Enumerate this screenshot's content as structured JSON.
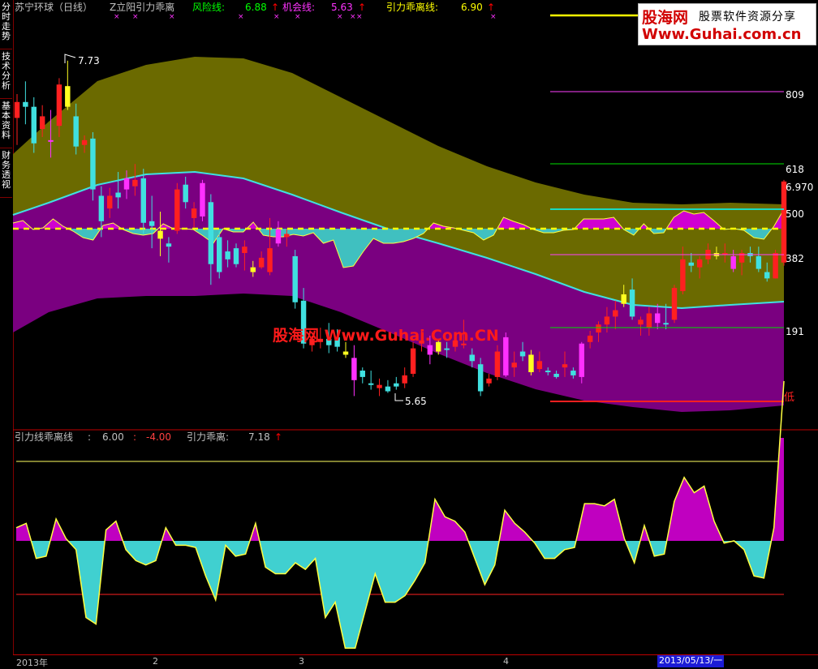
{
  "sidebar": {
    "tabs": [
      {
        "label": "分时走势"
      },
      {
        "label": "技术分析"
      },
      {
        "label": "基本资料"
      },
      {
        "label": "财务透视"
      }
    ]
  },
  "main_panel": {
    "title": "苏宁环球（日线）",
    "indicator_name": "Z立阳引力乖离",
    "risk_label": "风险线:",
    "risk_value": "6.88",
    "opportunity_label": "机会线:",
    "opportunity_value": "5.63",
    "gravity_label": "引力乖离线:",
    "gravity_value": "6.90",
    "high_marker": "7.73",
    "low_marker": "5.65",
    "current_price": "6.970",
    "levels": [
      "809",
      "618",
      "500",
      "382",
      "191",
      "低"
    ],
    "colors": {
      "risk": "#00ff00",
      "opportunity": "#ff33ff",
      "gravity": "#ffff00"
    }
  },
  "sub_panel": {
    "title": "引力线乖离线",
    "value1": "6.00",
    "value2": "-4.00",
    "label2": "引力乖离:",
    "value3": "7.18"
  },
  "dates": {
    "start": "2013年",
    "m2": "2",
    "m3": "3",
    "m4": "4",
    "cursor": "2013/05/13/一"
  },
  "logo": {
    "brand": "股海网",
    "slogan": "股票软件资源分享",
    "url": "Www.Guhai.com.cn"
  },
  "watermark": "股海网 Www.Guhai.Com.CN",
  "candles": [
    [
      7.37,
      7.52,
      7.2,
      7.47
    ],
    [
      7.47,
      7.6,
      7.33,
      7.44
    ],
    [
      7.44,
      7.5,
      7.15,
      7.21
    ],
    [
      7.3,
      7.45,
      7.25,
      7.38
    ],
    [
      7.23,
      7.42,
      7.12,
      7.22
    ],
    [
      7.32,
      7.62,
      7.25,
      7.58
    ],
    [
      7.57,
      7.73,
      7.42,
      7.44
    ],
    [
      7.38,
      7.46,
      7.14,
      7.19
    ],
    [
      7.2,
      7.26,
      7.15,
      7.23
    ],
    [
      7.24,
      7.28,
      6.85,
      6.92
    ],
    [
      6.88,
      6.94,
      6.62,
      6.72
    ],
    [
      6.8,
      6.93,
      6.74,
      6.88
    ],
    [
      6.9,
      7.03,
      6.8,
      6.87
    ],
    [
      6.92,
      7.04,
      6.86,
      6.99
    ],
    [
      6.94,
      7.08,
      6.88,
      6.98
    ],
    [
      6.99,
      7.05,
      6.64,
      6.71
    ],
    [
      6.72,
      6.88,
      6.55,
      6.69
    ],
    [
      6.66,
      6.78,
      6.5,
      6.61
    ],
    [
      6.58,
      6.62,
      6.46,
      6.56
    ],
    [
      6.66,
      6.96,
      6.64,
      6.92
    ],
    [
      6.95,
      7.0,
      6.8,
      6.84
    ],
    [
      6.74,
      6.84,
      6.68,
      6.8
    ],
    [
      6.75,
      6.98,
      6.72,
      6.96
    ],
    [
      6.84,
      6.89,
      6.32,
      6.45
    ],
    [
      6.62,
      6.66,
      6.36,
      6.4
    ],
    [
      6.53,
      6.6,
      6.43,
      6.48
    ],
    [
      6.55,
      6.58,
      6.43,
      6.45
    ],
    [
      6.52,
      6.6,
      6.41,
      6.56
    ],
    [
      6.43,
      6.47,
      6.37,
      6.4
    ],
    [
      6.43,
      6.53,
      6.42,
      6.49
    ],
    [
      6.4,
      6.74,
      6.38,
      6.55
    ],
    [
      6.58,
      6.72,
      6.56,
      6.67
    ],
    [
      6.62,
      6.67,
      6.56,
      6.64
    ],
    [
      6.5,
      6.54,
      6.17,
      6.21
    ],
    [
      6.22,
      6.3,
      5.92,
      5.95
    ],
    [
      5.94,
      6.0,
      5.9,
      5.98
    ],
    [
      5.96,
      6.05,
      5.92,
      5.98
    ],
    [
      5.98,
      6.08,
      5.89,
      5.94
    ],
    [
      5.99,
      6.04,
      5.9,
      5.93
    ],
    [
      5.9,
      5.96,
      5.86,
      5.88
    ],
    [
      5.86,
      5.94,
      5.62,
      5.72
    ],
    [
      5.78,
      5.8,
      5.7,
      5.74
    ],
    [
      5.7,
      5.78,
      5.66,
      5.69
    ],
    [
      5.67,
      5.73,
      5.62,
      5.69
    ],
    [
      5.68,
      5.72,
      5.64,
      5.65
    ],
    [
      5.7,
      5.74,
      5.66,
      5.68
    ],
    [
      5.7,
      5.8,
      5.67,
      5.75
    ],
    [
      5.76,
      5.96,
      5.74,
      5.92
    ],
    [
      5.95,
      6.04,
      5.9,
      5.97
    ],
    [
      5.94,
      6.0,
      5.82,
      5.88
    ],
    [
      5.9,
      5.98,
      5.88,
      5.96
    ],
    [
      5.92,
      5.96,
      5.86,
      5.91
    ],
    [
      5.93,
      6.0,
      5.9,
      5.97
    ],
    [
      5.95,
      6.1,
      5.92,
      5.95
    ],
    [
      5.88,
      5.92,
      5.8,
      5.84
    ],
    [
      5.82,
      5.86,
      5.62,
      5.65
    ],
    [
      5.7,
      5.76,
      5.68,
      5.73
    ],
    [
      5.74,
      5.94,
      5.72,
      5.9
    ],
    [
      5.99,
      6.02,
      5.74,
      5.75
    ],
    [
      5.8,
      5.9,
      5.74,
      5.83
    ],
    [
      5.9,
      5.96,
      5.84,
      5.87
    ],
    [
      5.88,
      5.91,
      5.75,
      5.77
    ],
    [
      5.79,
      5.9,
      5.77,
      5.84
    ],
    [
      5.78,
      5.8,
      5.75,
      5.77
    ],
    [
      5.76,
      5.78,
      5.73,
      5.74
    ],
    [
      5.8,
      5.9,
      5.74,
      5.82
    ],
    [
      5.78,
      5.8,
      5.73,
      5.75
    ],
    [
      5.74,
      5.96,
      5.7,
      5.95
    ],
    [
      5.96,
      6.03,
      5.92,
      6.0
    ],
    [
      6.02,
      6.09,
      5.96,
      6.07
    ],
    [
      6.07,
      6.18,
      6.02,
      6.12
    ],
    [
      6.12,
      6.22,
      6.04,
      6.16
    ],
    [
      6.2,
      6.32,
      6.18,
      6.26
    ],
    [
      6.29,
      6.36,
      6.1,
      6.12
    ],
    [
      6.07,
      6.12,
      6.0,
      6.1
    ],
    [
      6.05,
      6.18,
      6.0,
      6.14
    ],
    [
      6.14,
      6.2,
      6.04,
      6.08
    ],
    [
      6.08,
      6.2,
      6.04,
      6.07
    ],
    [
      6.1,
      6.32,
      6.08,
      6.3
    ],
    [
      6.28,
      6.56,
      6.26,
      6.48
    ],
    [
      6.46,
      6.52,
      6.4,
      6.44
    ],
    [
      6.43,
      6.5,
      6.36,
      6.48
    ],
    [
      6.48,
      6.58,
      6.45,
      6.54
    ],
    [
      6.52,
      6.56,
      6.48,
      6.5
    ],
    [
      6.52,
      6.58,
      6.46,
      6.52
    ],
    [
      6.5,
      6.54,
      6.4,
      6.42
    ],
    [
      6.46,
      6.54,
      6.38,
      6.52
    ],
    [
      6.52,
      6.56,
      6.46,
      6.5
    ],
    [
      6.5,
      6.56,
      6.4,
      6.42
    ],
    [
      6.4,
      6.46,
      6.34,
      6.36
    ],
    [
      6.36,
      6.54,
      6.36,
      6.52
    ],
    [
      6.46,
      6.98,
      6.44,
      6.97
    ]
  ],
  "sub_osc": [
    0.6,
    0.8,
    -0.8,
    -0.7,
    1.0,
    0.1,
    -0.4,
    -3.5,
    -3.8,
    0.5,
    0.9,
    -0.4,
    -0.9,
    -1.1,
    -0.9,
    0.6,
    -0.2,
    -0.2,
    -0.3,
    -1.6,
    -2.7,
    -0.2,
    -0.7,
    -0.6,
    0.8,
    -1.2,
    -1.5,
    -1.5,
    -1.0,
    -1.3,
    -0.8,
    -3.5,
    -2.8,
    -4.9,
    -4.9,
    -3.2,
    -1.5,
    -2.8,
    -2.8,
    -2.5,
    -1.8,
    -1.0,
    1.9,
    1.1,
    0.9,
    0.4,
    -0.8,
    -2.0,
    -1.1,
    1.4,
    0.8,
    0.4,
    -0.1,
    -0.8,
    -0.8,
    -0.4,
    -0.3,
    1.7,
    1.7,
    1.6,
    1.9,
    0.1,
    -1.0,
    0.7,
    -0.7,
    -0.6,
    1.8,
    2.9,
    2.2,
    2.5,
    0.9,
    -0.1,
    0.0,
    -0.4,
    -1.6,
    -1.7,
    0.6,
    7.3
  ]
}
